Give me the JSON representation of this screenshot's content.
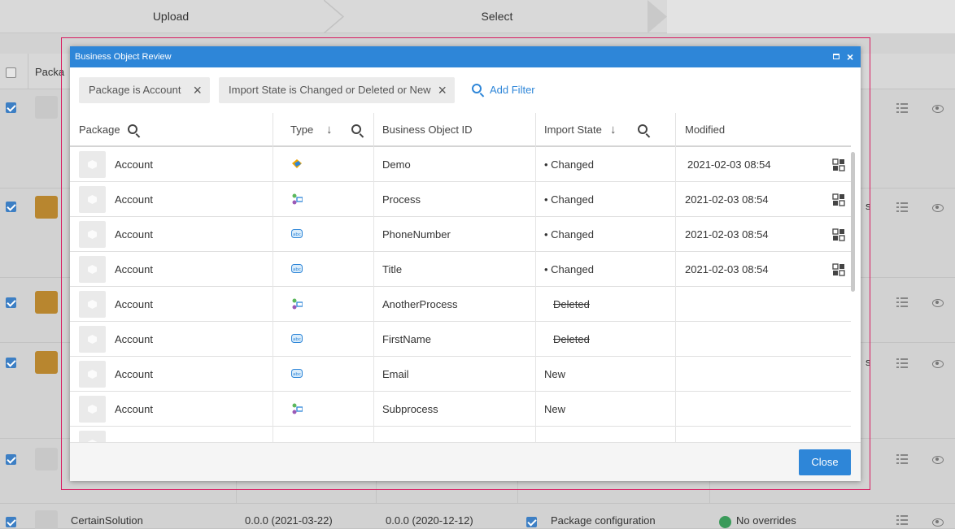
{
  "wizard": {
    "steps": [
      "Upload",
      "Select"
    ]
  },
  "background": {
    "package_col_label": "Packa",
    "bottom_row": {
      "name": "CertainSolution",
      "version_a": "0.0.0 (2021-03-22)",
      "version_b": "0.0.0 (2020-12-12)",
      "config_label": "Package configuration",
      "override_label": "No overrides"
    },
    "trailing_s": "s"
  },
  "dialog": {
    "title": "Business Object Review",
    "filters": [
      "Package is Account",
      "Import State is Changed or Deleted or New"
    ],
    "add_filter_label": "Add Filter",
    "columns": {
      "package": "Package",
      "type": "Type",
      "id": "Business Object ID",
      "state": "Import State",
      "modified": "Modified"
    },
    "rows": [
      {
        "package": "Account",
        "type_icon": "object-type-icon",
        "id": "Demo",
        "state": "• Changed",
        "modified": "2021-02-03 08:54"
      },
      {
        "package": "Account",
        "type_icon": "process-type-icon",
        "id": "Process",
        "state": "• Changed",
        "modified": "2021-02-03 08:54"
      },
      {
        "package": "Account",
        "type_icon": "text-field-type-icon",
        "id": "PhoneNumber",
        "state": "• Changed",
        "modified": "2021-02-03 08:54"
      },
      {
        "package": "Account",
        "type_icon": "text-field-type-icon",
        "id": "Title",
        "state": "• Changed",
        "modified": "2021-02-03 08:54"
      },
      {
        "package": "Account",
        "type_icon": "process-type-icon",
        "id": "AnotherProcess",
        "state": "Deleted",
        "modified": ""
      },
      {
        "package": "Account",
        "type_icon": "text-field-type-icon",
        "id": "FirstName",
        "state": "Deleted",
        "modified": ""
      },
      {
        "package": "Account",
        "type_icon": "text-field-type-icon",
        "id": "Email",
        "state": "New",
        "modified": ""
      },
      {
        "package": "Account",
        "type_icon": "process-type-icon",
        "id": "Subprocess",
        "state": "New",
        "modified": ""
      }
    ],
    "close_label": "Close"
  },
  "colors": {
    "accent": "#2e86d8",
    "highlight": "#d81b60"
  }
}
